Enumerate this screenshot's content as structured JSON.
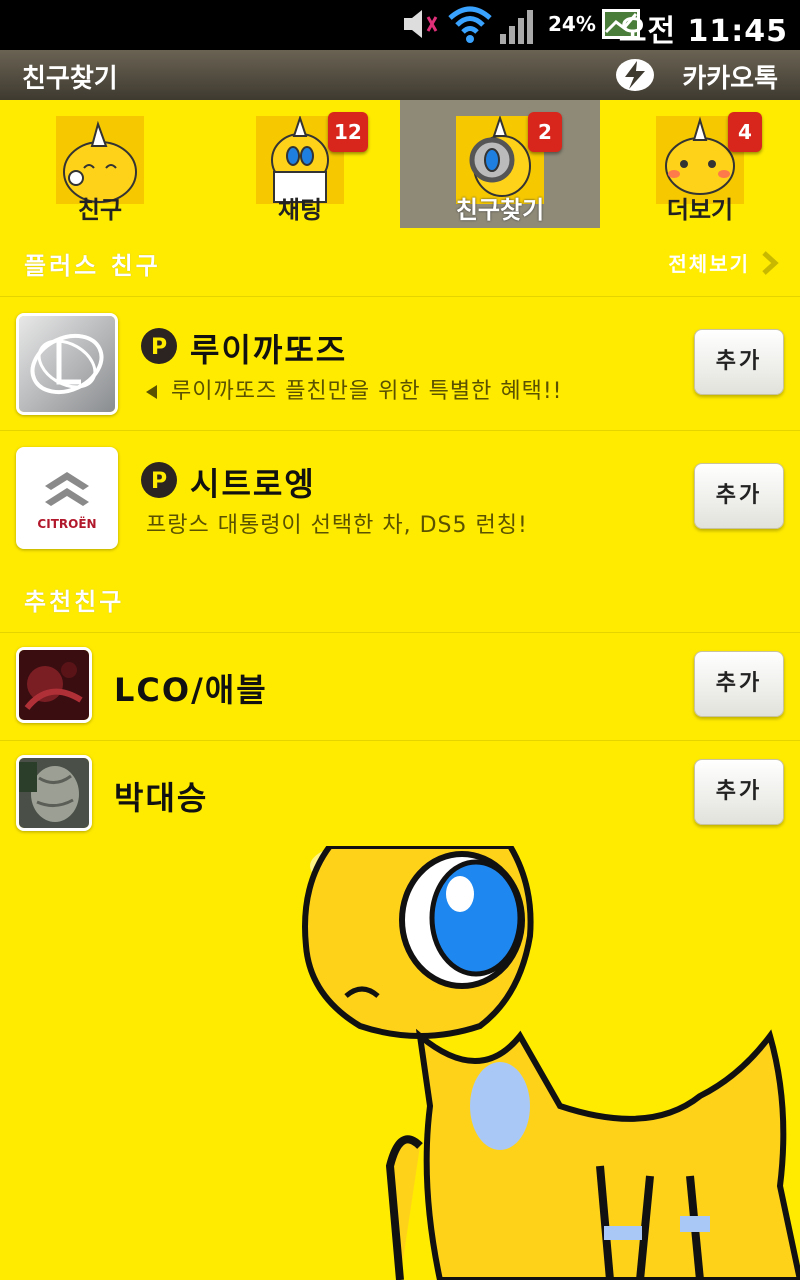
{
  "status_bar": {
    "battery": "24%",
    "time": "오전 11:45",
    "icons": [
      "mute-icon",
      "wifi-icon",
      "signal-icon",
      "chart-icon"
    ]
  },
  "title_bar": {
    "title": "친구찾기",
    "brand": "카카오톡",
    "brand_icon": "kakao-bolt-icon"
  },
  "tabs": [
    {
      "label": "친구",
      "badge": "",
      "selected": false
    },
    {
      "label": "채팅",
      "badge": "12",
      "selected": false
    },
    {
      "label": "친구찾기",
      "badge": "2",
      "selected": true
    },
    {
      "label": "더보기",
      "badge": "4",
      "selected": false
    }
  ],
  "plus_friends": {
    "header": "플러스 친구",
    "view_all": "전체보기",
    "items": [
      {
        "name": "루이까또즈",
        "desc": "루이까또즈 플친만을 위한 특별한 혜택!!",
        "add_label": "추가"
      },
      {
        "name": "시트로엥",
        "desc": "프랑스 대통령이 선택한 차, DS5 런칭!",
        "add_label": "추가"
      }
    ]
  },
  "recommended": {
    "header": "추천친구",
    "items": [
      {
        "name": "LCO/애블",
        "add_label": "추가"
      },
      {
        "name": "박대승",
        "add_label": "추가"
      }
    ]
  },
  "logos": {
    "citroen_text": "CITROËN"
  },
  "colors": {
    "background": "#FFEB00",
    "badge": "#D8261C",
    "selected_tab": "#8F8A78"
  }
}
